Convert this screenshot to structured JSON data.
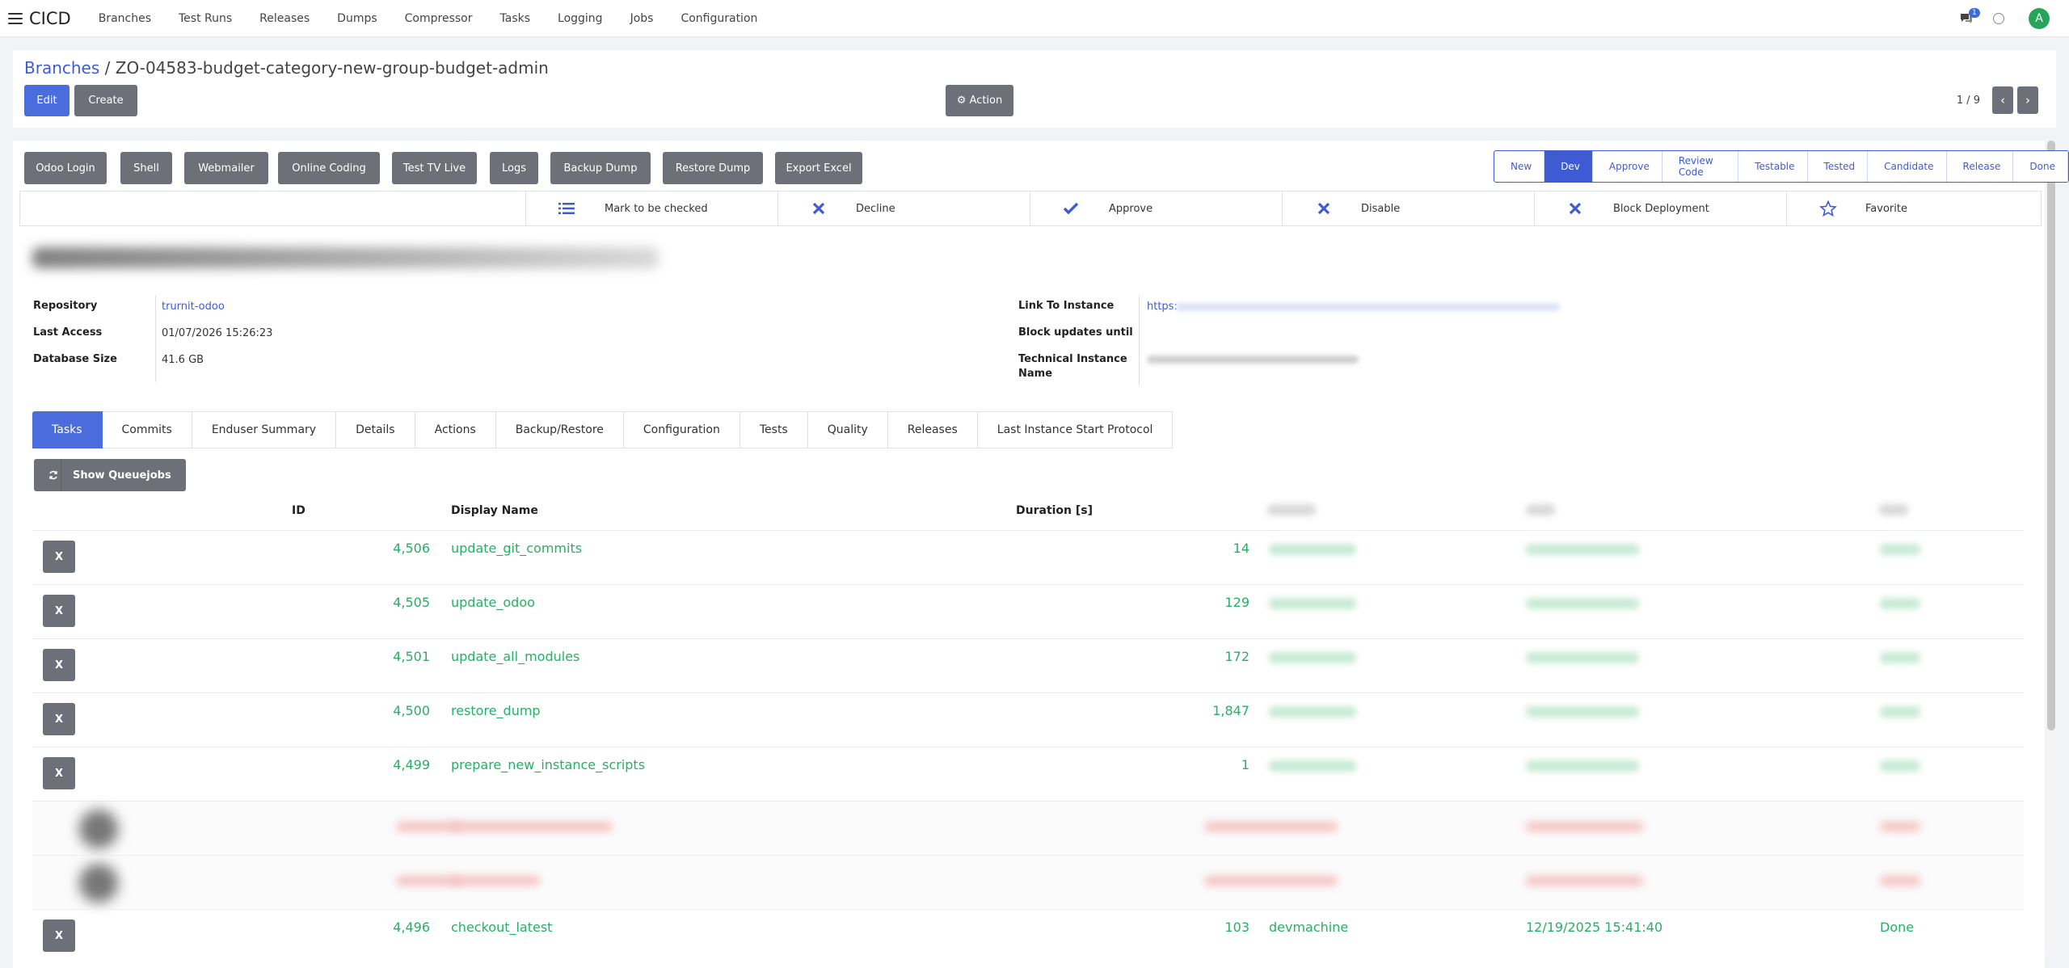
{
  "app": {
    "brand": "CICD"
  },
  "menu": [
    "Branches",
    "Test Runs",
    "Releases",
    "Dumps",
    "Compressor",
    "Tasks",
    "Logging",
    "Jobs",
    "Configuration"
  ],
  "topbar": {
    "chat_badge": "1",
    "avatar_letter": "A"
  },
  "breadcrumb": {
    "parent": "Branches",
    "separator": "/",
    "current": "ZO-04583-budget-category-new-group-budget-admin"
  },
  "controls": {
    "edit": "Edit",
    "create": "Create",
    "action": "⚙ Action",
    "pager": "1 / 9"
  },
  "header_buttons": [
    "Odoo Login",
    "Shell",
    "Webmailer",
    "Online Coding",
    "Test TV Live",
    "Logs",
    "Backup Dump",
    "Restore Dump",
    "Export Excel"
  ],
  "stages": {
    "items": [
      "New",
      "Dev",
      "Approve",
      "Review Code",
      "Testable",
      "Tested",
      "Candidate",
      "Release",
      "Done"
    ],
    "active": "Dev"
  },
  "smart_buttons": [
    {
      "label": "Mark to be checked",
      "icon": "list-icon"
    },
    {
      "label": "Decline",
      "icon": "x-icon"
    },
    {
      "label": "Approve",
      "icon": "check-icon"
    },
    {
      "label": "Disable",
      "icon": "x-icon"
    },
    {
      "label": "Block Deployment",
      "icon": "x-icon"
    },
    {
      "label": "Favorite",
      "icon": "star-icon"
    }
  ],
  "fields": {
    "repository_label": "Repository",
    "repository": "trurnit-odoo",
    "last_access_label": "Last Access",
    "last_access": "01/07/2026 15:26:23",
    "db_size_label": "Database Size",
    "db_size": "41.6 GB",
    "link_label": "Link To Instance",
    "link": "https:",
    "block_label": "Block updates until",
    "tech_label_1": "Technical Instance",
    "tech_label_2": "Name"
  },
  "tabs": [
    "Tasks",
    "Commits",
    "Enduser Summary",
    "Details",
    "Actions",
    "Backup/Restore",
    "Configuration",
    "Tests",
    "Quality",
    "Releases",
    "Last Instance Start Protocol"
  ],
  "show_queuejobs": "Show Queuejobs",
  "table": {
    "headers": {
      "id": "ID",
      "name": "Display Name",
      "duration": "Duration [s]"
    },
    "rows": [
      {
        "x": "X",
        "id": "4,506",
        "name": "update_git_commits",
        "duration": "14"
      },
      {
        "x": "X",
        "id": "4,505",
        "name": "update_odoo",
        "duration": "129"
      },
      {
        "x": "X",
        "id": "4,501",
        "name": "update_all_modules",
        "duration": "172"
      },
      {
        "x": "X",
        "id": "4,500",
        "name": "restore_dump",
        "duration": "1,847"
      },
      {
        "x": "X",
        "id": "4,499",
        "name": "prepare_new_instance_scripts",
        "duration": "1"
      }
    ],
    "last_row": {
      "x": "X",
      "id": "4,496",
      "name": "checkout_latest",
      "duration": "103",
      "machine": "devmachine",
      "date": "12/19/2025 15:41:40",
      "state": "Done"
    }
  },
  "colors": {
    "accent": "#4b6cdc",
    "success": "#27b064",
    "button_grey": "#6e7079"
  }
}
